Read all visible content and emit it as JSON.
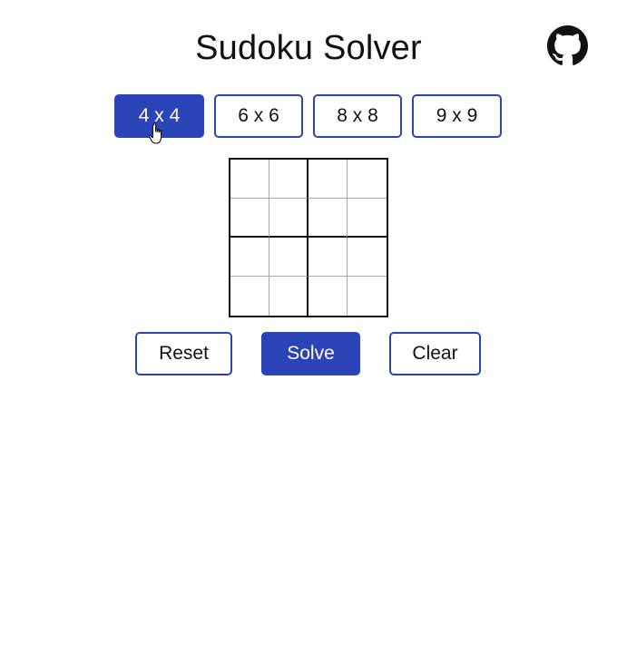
{
  "header": {
    "title": "Sudoku Solver",
    "github_icon": "github-icon"
  },
  "size_options": [
    {
      "label": "4 x 4",
      "active": true
    },
    {
      "label": "6 x 6",
      "active": false
    },
    {
      "label": "8 x 8",
      "active": false
    },
    {
      "label": "9 x 9",
      "active": false
    }
  ],
  "board": {
    "size": 4,
    "box_rows": 2,
    "box_cols": 2,
    "cells": [
      [
        "",
        "",
        "",
        ""
      ],
      [
        "",
        "",
        "",
        ""
      ],
      [
        "",
        "",
        "",
        ""
      ],
      [
        "",
        "",
        "",
        ""
      ]
    ]
  },
  "actions": {
    "reset_label": "Reset",
    "solve_label": "Solve",
    "clear_label": "Clear"
  },
  "colors": {
    "accent": "#2b44b7",
    "grid_thick": "#111111",
    "grid_thin": "#a8a8a8",
    "background": "#ffffff"
  }
}
